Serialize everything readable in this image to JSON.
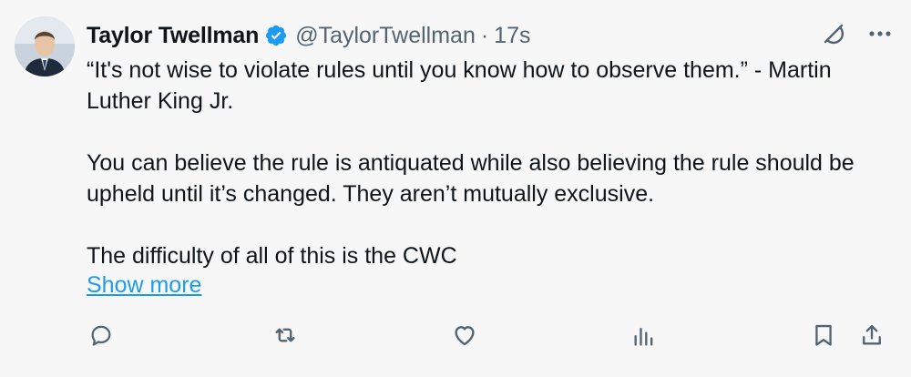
{
  "tweet": {
    "author_name": "Taylor Twellman",
    "handle": "@TaylorTwellman",
    "separator": "·",
    "time": "17s",
    "paragraphs": [
      "“It's not wise to violate rules until you know how to observe them.” - Martin Luther King Jr.",
      "You can believe the rule is antiquated while also believing the rule should be upheld until it’s changed. They aren’t mutually exclusive.",
      "The difficulty of all of this is the CWC"
    ],
    "show_more": "Show more"
  },
  "icons": {
    "verified": "verified-badge-icon",
    "grok": "grok-icon",
    "more": "more-icon",
    "reply": "reply-icon",
    "retweet": "retweet-icon",
    "like": "like-icon",
    "views": "views-icon",
    "bookmark": "bookmark-icon",
    "share": "share-icon"
  },
  "colors": {
    "background": "#f7f7f7",
    "text": "#0f1419",
    "secondary": "#536471",
    "accent": "#1d9bf0"
  }
}
